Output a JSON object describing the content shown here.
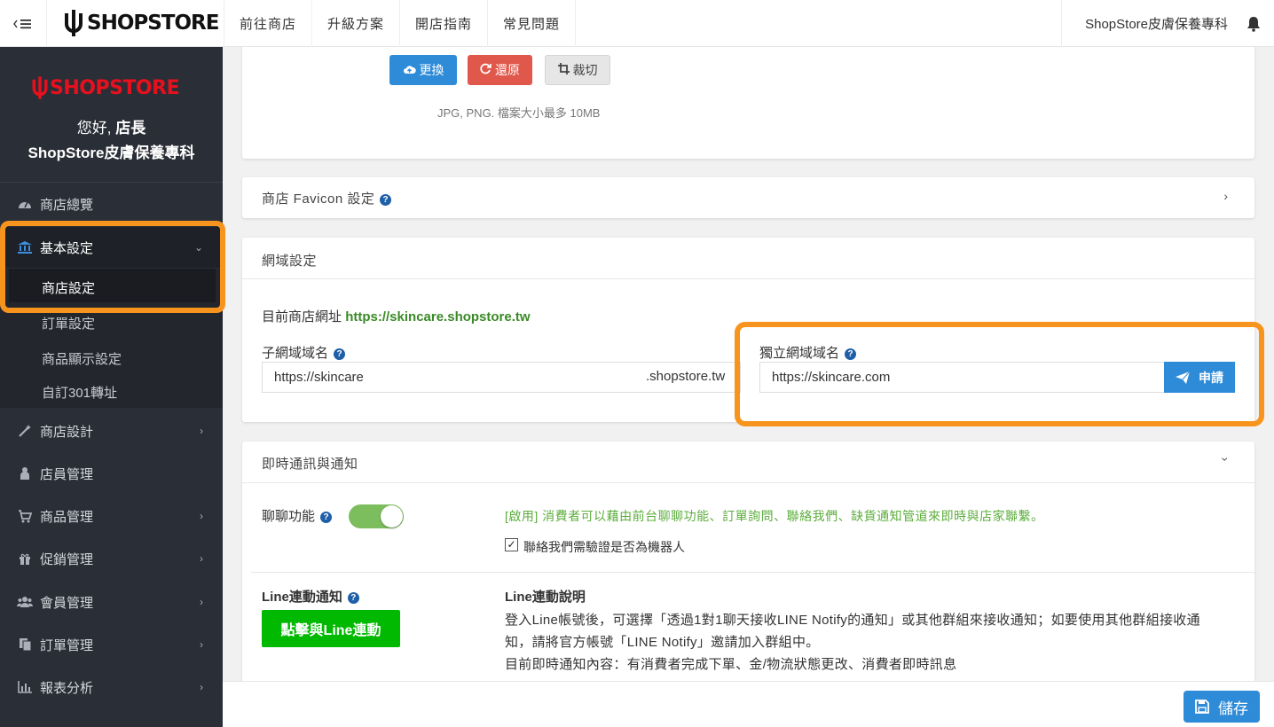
{
  "topbar": {
    "toggle_icon": "sidebar-toggle-icon",
    "logo_text": "SHOPSTORE",
    "nav": [
      "前往商店",
      "升級方案",
      "開店指南",
      "常見問題"
    ],
    "store_name": "ShopStore皮膚保養專科",
    "bell_icon": "bell-icon"
  },
  "sidebar": {
    "logo_text": "SHOPSTORE",
    "greeting_prefix": "您好, ",
    "greeting_role": "店長",
    "store_name": "ShopStore皮膚保養專科",
    "items": [
      {
        "label": "商店總覽",
        "icon": "dashboard-icon"
      },
      {
        "label": "基本設定",
        "icon": "bank-icon"
      },
      {
        "label": "商店設計",
        "icon": "magic-wand-icon"
      },
      {
        "label": "店員管理",
        "icon": "staff-icon"
      },
      {
        "label": "商品管理",
        "icon": "cart-icon"
      },
      {
        "label": "促銷管理",
        "icon": "gift-icon"
      },
      {
        "label": "會員管理",
        "icon": "users-icon"
      },
      {
        "label": "訂單管理",
        "icon": "orders-icon"
      },
      {
        "label": "報表分析",
        "icon": "bar-chart-icon"
      }
    ],
    "submenu": [
      "商店設定",
      "訂單設定",
      "商品顯示設定",
      "自訂301轉址"
    ]
  },
  "logo_card": {
    "replace_label": "更換",
    "restore_label": "還原",
    "crop_label": "裁切",
    "hint": "JPG, PNG. 檔案大小最多 10MB"
  },
  "favicon_card": {
    "title": "商店 Favicon 設定"
  },
  "domain_card": {
    "title": "網域設定",
    "current_label": "目前商店網址",
    "current_url": "https://skincare.shopstore.tw",
    "subdomain_label": "子網域域名",
    "subdomain_value": "https://skincare",
    "subdomain_suffix": ".shopstore.tw",
    "custom_label": "獨立網域域名",
    "custom_value": "https://skincare.com",
    "apply_label": "申請"
  },
  "notify_card": {
    "title": "即時通訊與通知",
    "chat_label": "聊聊功能",
    "chat_enabled": true,
    "chat_desc": "[啟用] 消費者可以藉由前台聊聊功能、訂單詢問、聯絡我們、缺貨通知管道來即時與店家聯繫。",
    "robot_check_label": "聯絡我們需驗證是否為機器人",
    "robot_checked": true,
    "line_label": "Line連動通知",
    "line_button": "點擊與Line連動",
    "line_desc_title": "Line連動說明",
    "line_desc_1": "登入Line帳號後，可選擇「透過1對1聊天接收LINE Notify的通知」或其他群組來接收通知；如要使用其他群組接收通",
    "line_desc_2": "知，請將官方帳號「LINE Notify」邀請加入群組中。",
    "line_desc_3": "目前即時通知內容：有消費者完成下單、金/物流狀態更改、消費者即時訊息"
  },
  "footer": {
    "save_label": "儲存"
  },
  "colors": {
    "sidebar_bg": "#2a2e36",
    "accent_blue": "#2e8bd8",
    "highlight_orange": "#f7941d",
    "line_green": "#00b900",
    "brand_red": "#e8101e"
  }
}
